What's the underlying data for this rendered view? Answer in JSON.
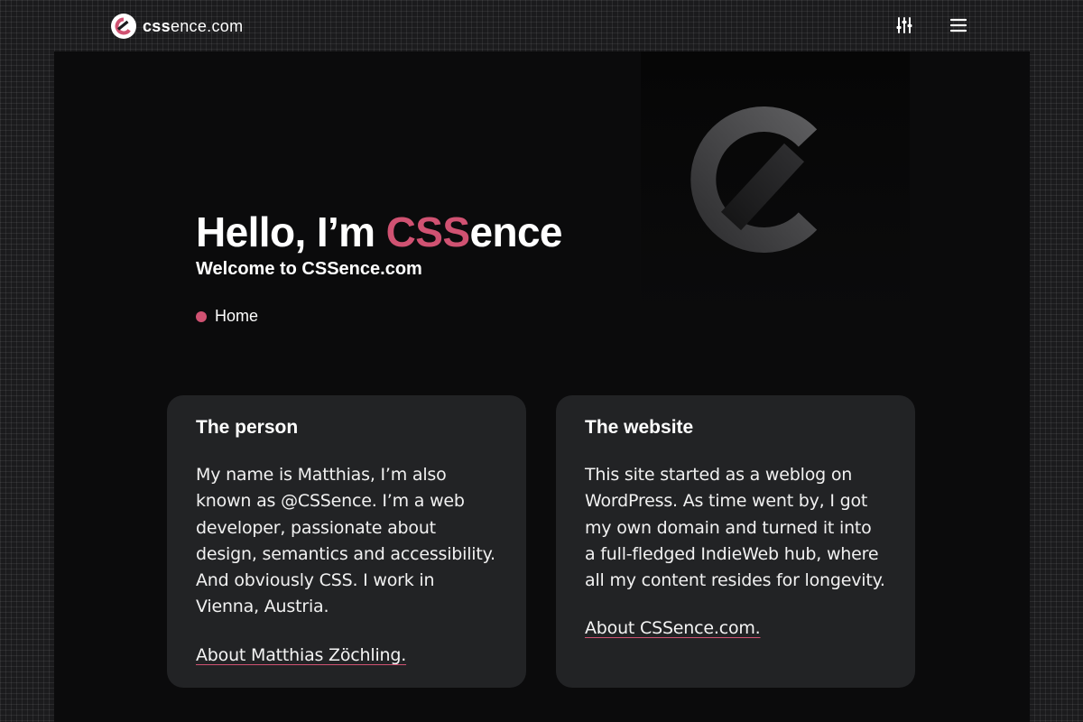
{
  "header": {
    "brand_bold": "css",
    "brand_rest": "ence.com",
    "settings_icon": "sliders-icon",
    "menu_icon": "hamburger-menu-icon"
  },
  "hero": {
    "title_before": "Hello, I’m ",
    "title_accent": "CSS",
    "title_after": "ence",
    "subtitle": "Welcome to CSSence.com",
    "breadcrumb": "Home"
  },
  "cards": [
    {
      "heading": "The person",
      "body": "My name is Matthias, I’m also known as @CSSence. I’m a web developer, passionate about design, semantics and accessibility. And obviously CSS. I work in Vienna, Austria.",
      "link": "About Matthias Zöchling."
    },
    {
      "heading": "The website",
      "body": "This site started as a weblog on WordPress. As time went by, I got my own domain and turned it into a full-fledged IndieWeb hub, where all my content resides for longevity.",
      "link": "About CSSence.com."
    }
  ],
  "colors": {
    "accent": "#d05272",
    "page_background": "#1b1b1d",
    "panel": "#0b0b0c",
    "card": "#222325"
  }
}
